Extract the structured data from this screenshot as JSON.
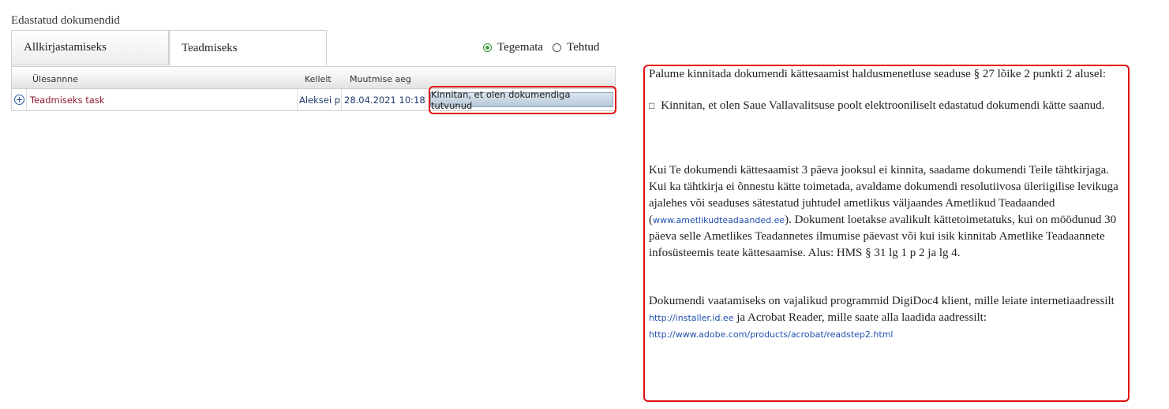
{
  "page": {
    "title": "Edastatud dokumendid"
  },
  "tabs": [
    {
      "label": "Allkirjastamiseks"
    },
    {
      "label": "Teadmiseks"
    }
  ],
  "filter": {
    "options": [
      {
        "label": "Tegemata",
        "checked": true
      },
      {
        "label": "Tehtud",
        "checked": false
      }
    ]
  },
  "table": {
    "columns": {
      "task": "Ülesannne",
      "from": "Kellelt",
      "time": "Muutmise aeg"
    },
    "rows": [
      {
        "task": "Teadmiseks task",
        "from": "Aleksei p",
        "time": "28.04.2021 10:18",
        "action": "Kinnitan, et olen dokumendiga tutvunud"
      }
    ]
  },
  "info": {
    "intro": "Palume kinnitada dokumendi kättesaamist haldusmenetluse seaduse § 27 lõike 2 punkti 2 alusel:",
    "checkbox_glyph": "□",
    "confirm_text": "Kinnitan, et olen Saue Vallavalitsuse poolt elektrooniliselt edastatud dokumendi kätte saanud.",
    "notice_part1": "Kui Te dokumendi kättesaamist 3 päeva jooksul ei kinnita, saadame dokumendi Teile tähtkirjaga. Kui ka tähtkirja ei õnnestu kätte toimetada, avaldame dokumendi resolutiivosa üleriigilise levikuga ajalehes või seaduses sätestatud juhtudel ametlikus väljaandes Ametlikud Teadaanded (",
    "notice_link": "www.ametlikudteadaanded.ee",
    "notice_part2": "). Dokument loetakse avalikult kättetoimetatuks, kui on möödunud 30 päeva selle Ametlikes Teadannetes ilmumise päevast või kui isik kinnitab Ametlike Teadaannete infosüsteemis teate kättesaamise. Alus: HMS § 31 lg 1 p 2 ja lg 4.",
    "programs_part1": "Dokumendi vaatamiseks on vajalikud  programmid DigiDoc4 klient, mille leiate internetiaadressilt ",
    "programs_link1": "http://installer.id.ee",
    "programs_part2": "  ja Acrobat Reader, mille saate alla laadida aadressilt: ",
    "programs_link2": "http://www.adobe.com/products/acrobat/readstep2.html"
  },
  "colors": {
    "highlight": "#e01010",
    "task_link": "#8b1a2e",
    "radio_checked": "#3aa33a"
  }
}
